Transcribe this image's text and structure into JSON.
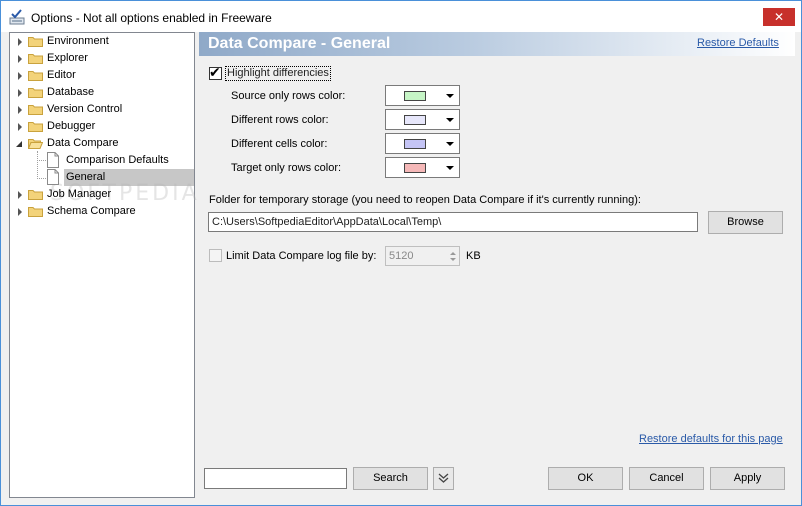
{
  "window": {
    "title": "Options - Not all options enabled in Freeware",
    "close_label": "✕"
  },
  "tree": {
    "items": [
      {
        "label": "Environment",
        "type": "folder",
        "expanded": false
      },
      {
        "label": "Explorer",
        "type": "folder",
        "expanded": false
      },
      {
        "label": "Editor",
        "type": "folder",
        "expanded": false
      },
      {
        "label": "Database",
        "type": "folder",
        "expanded": false
      },
      {
        "label": "Version Control",
        "type": "folder",
        "expanded": false
      },
      {
        "label": "Debugger",
        "type": "folder",
        "expanded": false
      },
      {
        "label": "Data Compare",
        "type": "folder",
        "expanded": true
      },
      {
        "label": "Comparison Defaults",
        "type": "page",
        "child": true
      },
      {
        "label": "General",
        "type": "page",
        "child": true,
        "selected": true
      },
      {
        "label": "Job Manager",
        "type": "folder",
        "expanded": false
      },
      {
        "label": "Schema Compare",
        "type": "folder",
        "expanded": false
      }
    ]
  },
  "header": {
    "title": "Data Compare - General",
    "restore_defaults": "Restore Defaults"
  },
  "content": {
    "highlight_label": "Highlight differencies",
    "highlight_checked": true,
    "colors": [
      {
        "label": "Source only rows color:",
        "color": "#c6f5c6"
      },
      {
        "label": "Different rows color:",
        "color": "#e6e6fa"
      },
      {
        "label": "Different cells color:",
        "color": "#c4c4f5"
      },
      {
        "label": "Target only rows color:",
        "color": "#f5b8b8"
      }
    ],
    "folder_label": "Folder for temporary storage (you need to reopen Data Compare if it's currently running):",
    "folder_value": "C:\\Users\\SoftpediaEditor\\AppData\\Local\\Temp\\",
    "browse_label": "Browse",
    "limit_label": "Limit Data Compare log file by:",
    "limit_checked": false,
    "limit_value": "5120",
    "limit_unit": "KB",
    "restore_page_link": "Restore defaults for this page"
  },
  "footer": {
    "search_value": "",
    "search_label": "Search",
    "ok_label": "OK",
    "cancel_label": "Cancel",
    "apply_label": "Apply"
  },
  "watermark": "SOFTPEDIA"
}
